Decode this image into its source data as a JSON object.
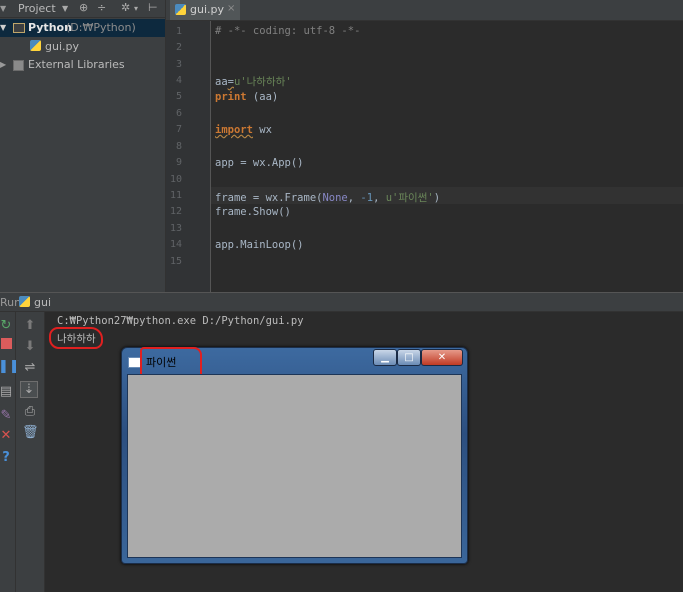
{
  "project": {
    "header_label": "Project",
    "root_name": "Python",
    "root_path": "(D:₩Python)",
    "file_name": "gui.py",
    "external": "External Libraries"
  },
  "editor": {
    "tab_label": "gui.py",
    "tab_close": "×",
    "line_numbers": [
      "1",
      "2",
      "3",
      "4",
      "5",
      "6",
      "7",
      "8",
      "9",
      "10",
      "11",
      "12",
      "13",
      "14",
      "15"
    ],
    "code": {
      "line1": "# -*- coding: utf-8 -*-",
      "line4_var": "aa",
      "line4_op": "=",
      "line4_str": "u'나하하하'",
      "line5_kw": "print",
      "line5_rest": " (aa)",
      "line7_kw": "import",
      "line7_rest": " wx",
      "line9": "app = wx.App()",
      "line11_a": "frame = wx.Frame(",
      "line11_none": "None",
      "line11_b": ", ",
      "line11_num": "-1",
      "line11_c": ", ",
      "line11_str": "u'파이썬'",
      "line11_d": ")",
      "line12": "frame.Show()",
      "line14": "app.MainLoop()"
    }
  },
  "run": {
    "label": "Run",
    "config_name": "gui",
    "command": "C:₩Python27₩python.exe D:/Python/gui.py",
    "output": "나하하하"
  },
  "window": {
    "title": "파이썬",
    "min_glyph": "▁",
    "max_glyph": "□",
    "close_glyph": "✕"
  },
  "colors": {
    "accent_red_annotation": "#e02020",
    "editor_bg": "#2b2b2b",
    "keyword": "#cc7832",
    "string": "#6a8759"
  }
}
